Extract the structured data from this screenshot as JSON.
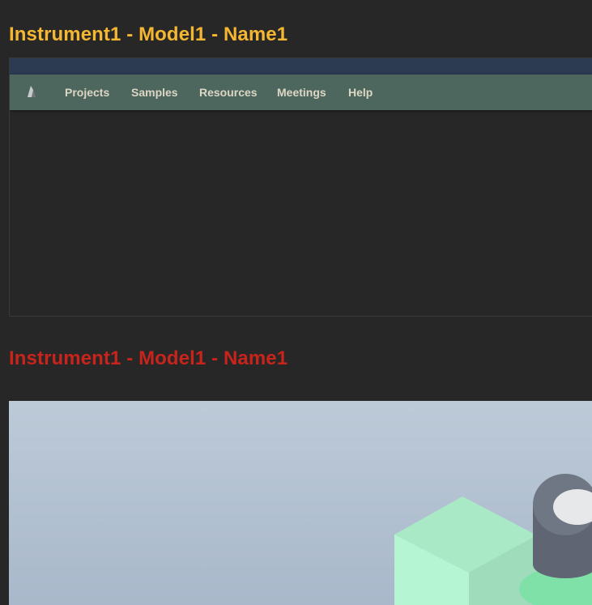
{
  "sections": [
    {
      "title": "Instrument1 - Model1 - Name1",
      "color": "#f5b731"
    },
    {
      "title": "Instrument1 - Model1 - Name1",
      "color": "#c8241c"
    }
  ],
  "embed": {
    "topbar_color": "#2c3a52",
    "nav_color": "#4e675e",
    "nav_text_color": "#dcd6c4",
    "logo_icon": "mountain-logo-icon",
    "nav_items": [
      {
        "label": "Projects"
      },
      {
        "label": "Samples"
      },
      {
        "label": "Resources"
      },
      {
        "label": "Meetings"
      },
      {
        "label": "Help"
      }
    ]
  },
  "viewer": {
    "background_top": "#bccad8",
    "background_bottom": "#a9b8ca",
    "model_colors": {
      "block": "#b5f5d3",
      "lens_ring": "#6f7684",
      "lens_inner": "#e6e8ea",
      "base_green": "#7fe0a8"
    }
  }
}
